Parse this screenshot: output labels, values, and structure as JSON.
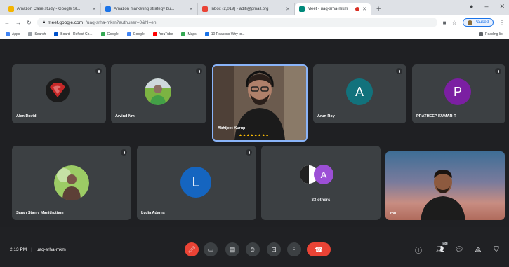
{
  "browser": {
    "tabs": [
      {
        "title": "Amazon Case study - Google Sl...",
        "favicon_color": "#f4b400",
        "active": false
      },
      {
        "title": "Amazon marketing strategy bu...",
        "favicon_color": "#1a73e8",
        "active": false
      },
      {
        "title": "Inbox (2,019) - aditi@gmail.org",
        "favicon_color": "#ea4335",
        "active": false
      },
      {
        "title": "Meet - uaq-srha-mkm",
        "favicon_color": "#00897b",
        "active": true
      }
    ],
    "new_tab_symbol": "+",
    "address": {
      "host": "meet.google.com",
      "path": "/uaq-srha-mkm?authuser=0&hl=en"
    },
    "profile_label": "Paused",
    "bookmarks": [
      {
        "label": "Apps",
        "color": "#4285f4"
      },
      {
        "label": "Search",
        "color": "#9aa0a6"
      },
      {
        "label": "Board · Reflect Co...",
        "color": "#0052cc"
      },
      {
        "label": "Google",
        "color": "#34a853"
      },
      {
        "label": "Google",
        "color": "#4285f4"
      },
      {
        "label": "YouTube",
        "color": "#ff0000"
      },
      {
        "label": "Maps",
        "color": "#34a853"
      },
      {
        "label": "10 Reasons Why to...",
        "color": "#1a73e8"
      }
    ],
    "reading_list": "Reading list"
  },
  "participants": [
    {
      "name": "Alen David",
      "avatar": "superman-logo-icon"
    },
    {
      "name": "Arvind Nm",
      "avatar": "photo"
    },
    {
      "name": "Abhijeet Kurup",
      "avatar": "video",
      "speaking": true
    },
    {
      "name": "Arun Roy",
      "initial": "A",
      "color": "#12727c"
    },
    {
      "name": "PRATHEEP KUMAR R",
      "initial": "P",
      "color": "#7b1fa2"
    },
    {
      "name": "Saran Stanly Manithottam",
      "avatar": "photo"
    },
    {
      "name": "Lydia Adams",
      "initial": "L",
      "color": "#1565c0"
    },
    {
      "name": "33 others",
      "initial": "A",
      "color": "#9c4fd6"
    },
    {
      "name": "You",
      "avatar": "video"
    }
  ],
  "meeting": {
    "time": "2:13 PM",
    "code": "uaq-srha-mkm"
  },
  "controls": {
    "participants_count": "40"
  }
}
